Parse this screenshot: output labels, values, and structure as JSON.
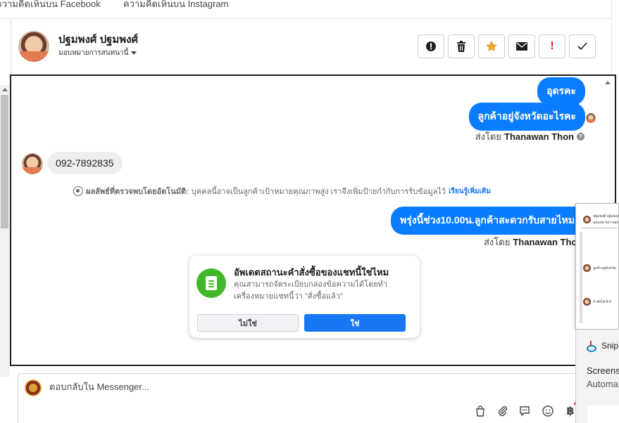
{
  "top_tabs": [
    "ความคิดเห็นบน Facebook",
    "ความคิดเห็นบน Instagram"
  ],
  "header": {
    "contact_name": "ปฐมพงศ์ ปฐมพงศ์",
    "assign_label": "มอบหมายการสนทนานี้",
    "toolbar": [
      {
        "name": "exclamation-circle-icon",
        "glyph": "⬤"
      },
      {
        "name": "trash-icon",
        "glyph": "🗑"
      },
      {
        "name": "star-icon",
        "glyph": "★"
      },
      {
        "name": "envelope-icon",
        "glyph": "✉"
      },
      {
        "name": "exclamation-icon",
        "glyph": "!"
      },
      {
        "name": "check-icon",
        "glyph": "✓"
      }
    ]
  },
  "messages": {
    "out_1": "อุดรคะ",
    "out_2": "ลูกค้าอยู่จังหวัดอะไรคะ",
    "sent_by_prefix": "ส่งโดย",
    "sent_by_name": "Thanawan Thon",
    "in_1": "092-7892835",
    "auto_detect_label": "ผลลัพธ์ที่ตรวจพบโดยอัตโนมัติ:",
    "auto_detect_text": "บุคคลนี้อาจเป็นลูกค้าเป้าหมายคุณภาพสูง เราจึงเพิ่มป้ายกำกับการรับข้อมูลไว้",
    "auto_detect_link": "เรียนรู้เพิ่มเติม",
    "out_3": "พรุ่งนี้ช่วง10.00น.ลูกค้าสะดวกรับสายไหมคะ"
  },
  "prompt": {
    "title": "อัพเดตสถานะคำสั่งซื้อของแชทนี้ใช่ไหม",
    "body": "คุณสามารถจัดระเบียบกล่องข้อความได้โดยทำเครื่องหมายแชทนี้ว่า \"สั่งซื้อแล้ว\"",
    "no_label": "ไม่ใช่",
    "yes_label": "ใช่"
  },
  "composer": {
    "placeholder": "ตอบกลับใน Messenger...",
    "icons": [
      "bag-icon",
      "paperclip-icon",
      "saved-reply-icon",
      "emoji-icon",
      "baht-icon"
    ]
  },
  "overlay": {
    "mini_header_name": "ปฐมพงศ์ ปฐมพงศ์",
    "mini_sub": "มอบหมายการสนทนานี้",
    "mini_row_1": "ลูกค้าอยู่จังหวัด",
    "mini_row_2": "ถ้าสั่งได้ 8-9",
    "snip_title": "Snip",
    "snip_line_1": "Screens",
    "snip_line_2": "Automa"
  },
  "colors": {
    "accent": "#0a7cff",
    "prompt_green": "#42b72a",
    "link_blue": "#1877f2"
  }
}
